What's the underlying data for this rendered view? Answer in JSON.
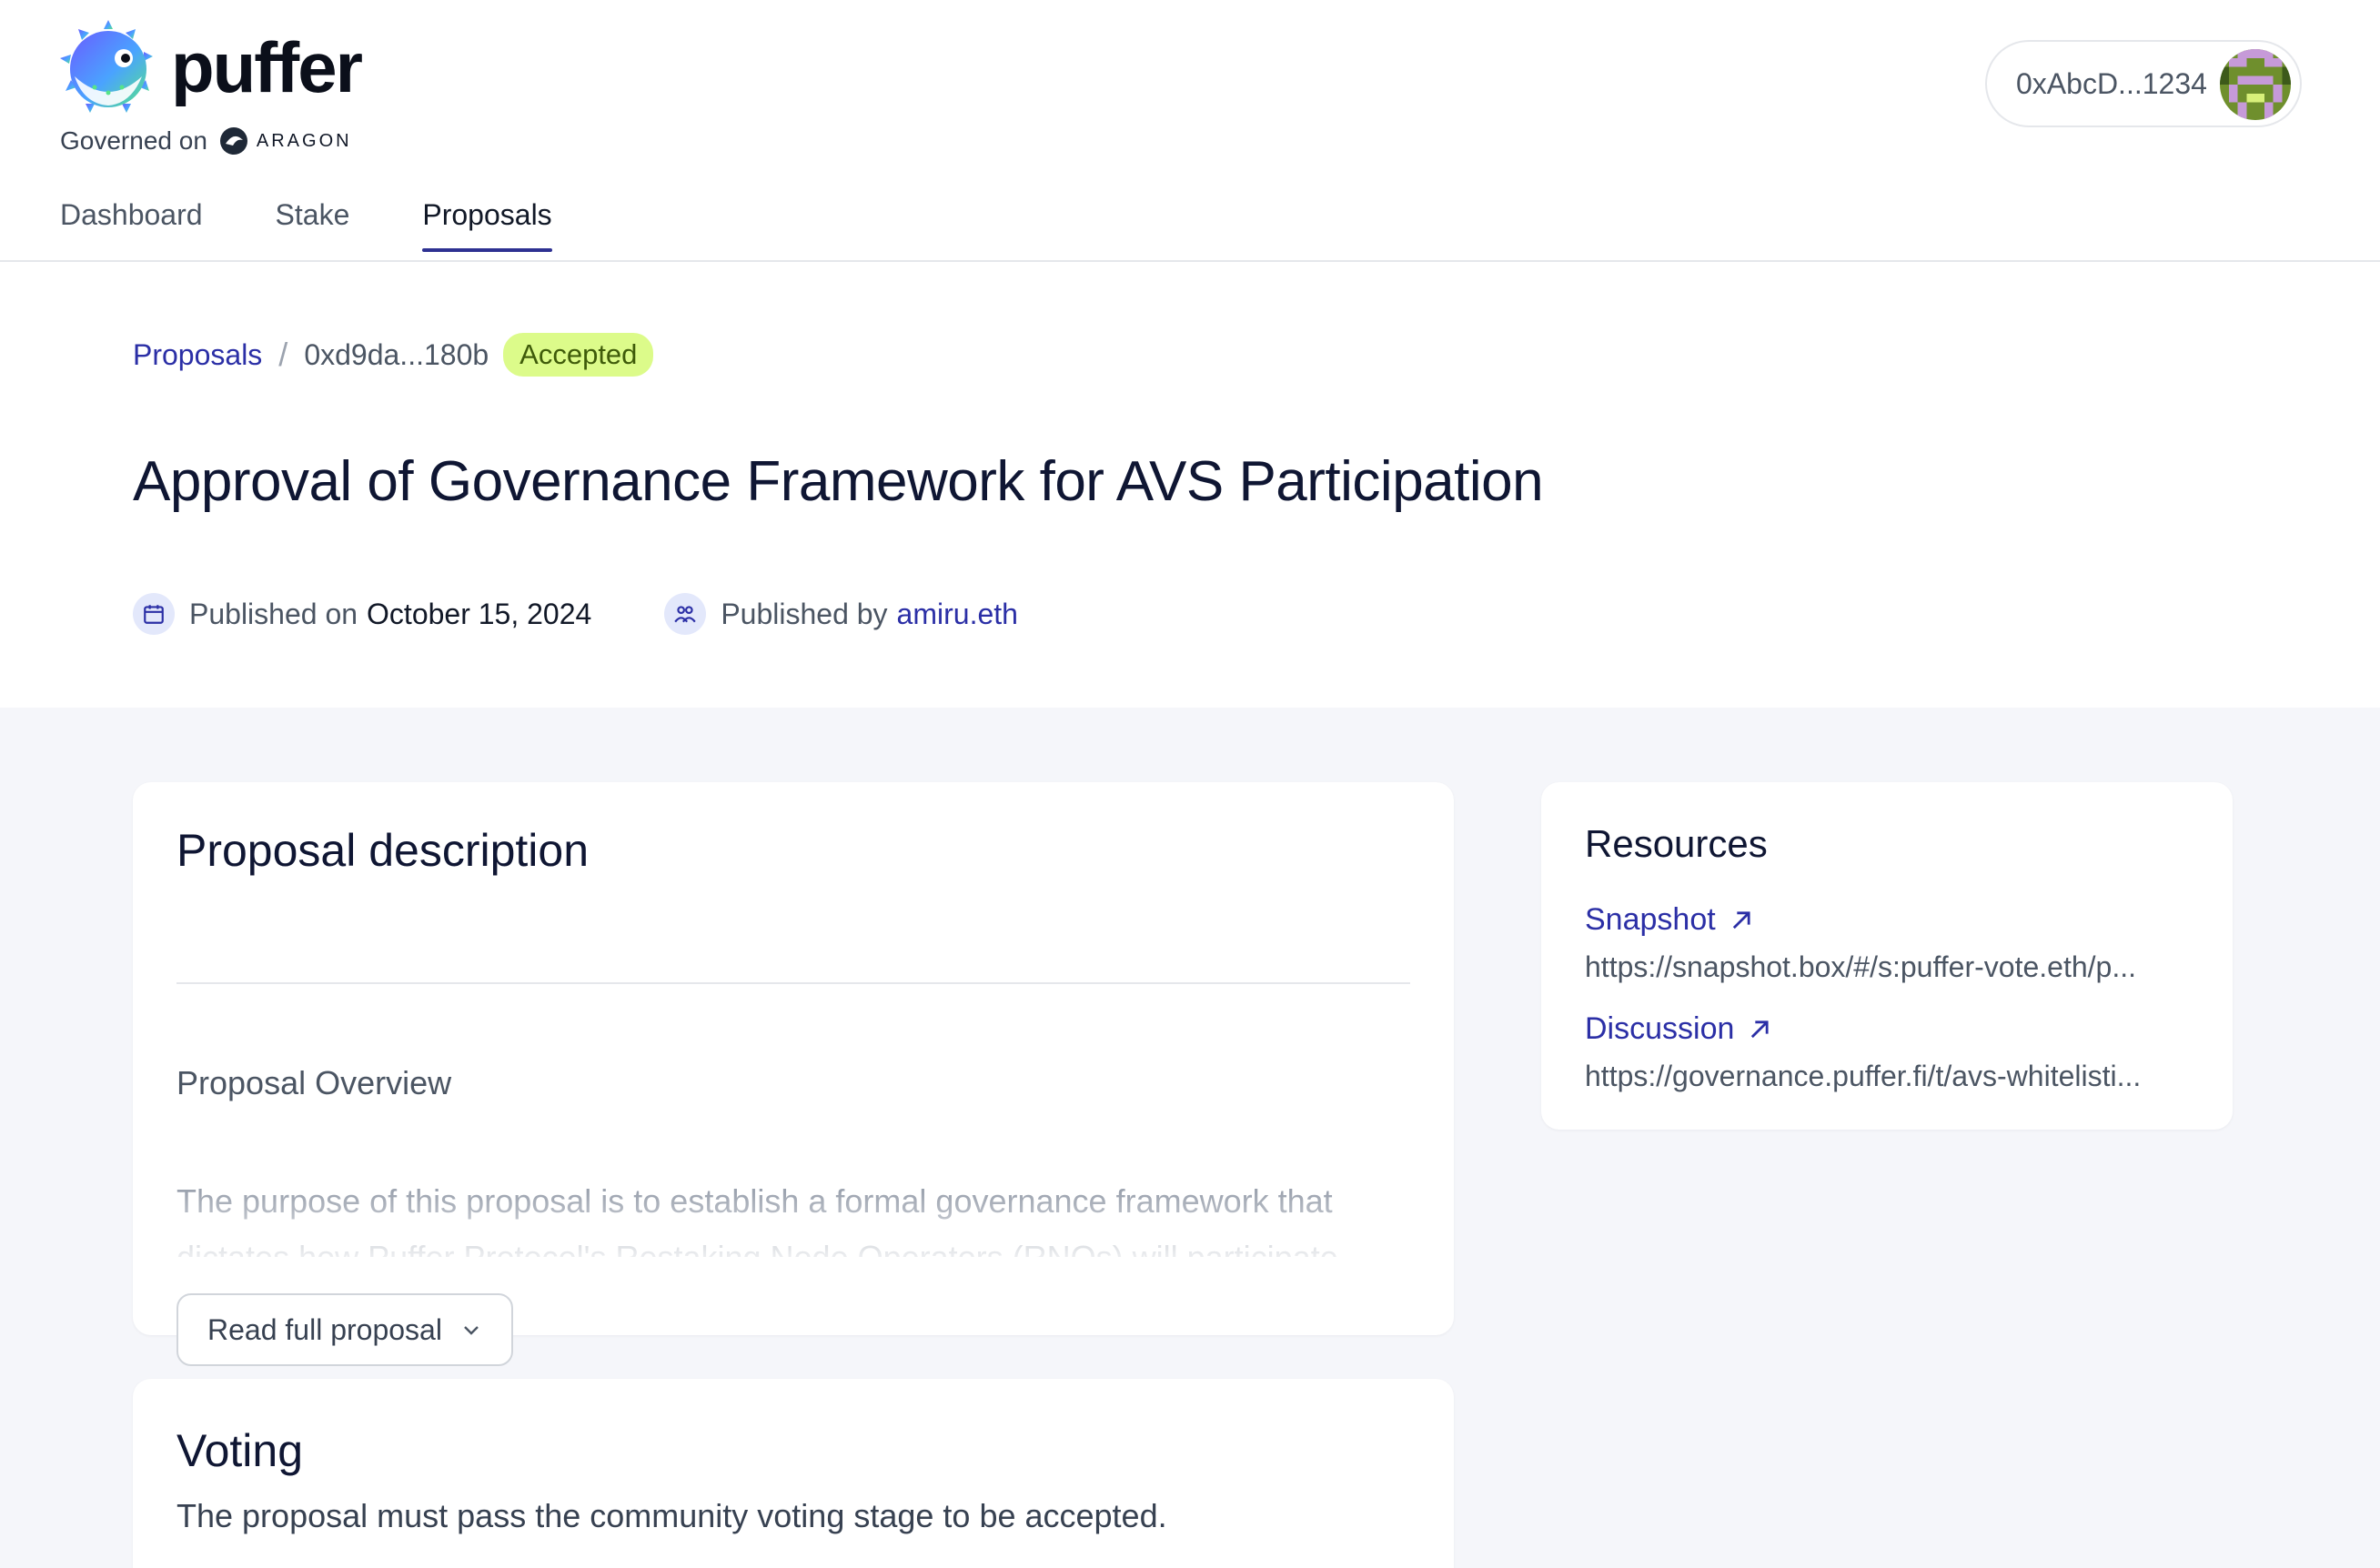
{
  "brand": {
    "name": "puffer",
    "governed_label": "Governed on",
    "aragon_label": "ARAGON"
  },
  "wallet": {
    "address": "0xAbcD...1234"
  },
  "nav": {
    "tabs": [
      {
        "label": "Dashboard",
        "active": false
      },
      {
        "label": "Stake",
        "active": false
      },
      {
        "label": "Proposals",
        "active": true
      }
    ]
  },
  "breadcrumb": {
    "root": "Proposals",
    "current": "0xd9da...180b",
    "status": "Accepted"
  },
  "proposal": {
    "title": "Approval of Governance Framework for AVS Participation",
    "published_on_label": "Published on",
    "published_on": "October 15, 2024",
    "published_by_label": "Published by",
    "published_by": "amiru.eth"
  },
  "description": {
    "heading": "Proposal description",
    "subheading": "Proposal Overview",
    "body": "The purpose of this proposal is to establish a formal governance framework that dictates how Puffer Protocol's Restaking Node Operators (RNOs) will participate",
    "read_more": "Read full proposal"
  },
  "voting": {
    "heading": "Voting",
    "subtext": "The proposal must pass the community voting stage to be accepted."
  },
  "resources": {
    "heading": "Resources",
    "items": [
      {
        "label": "Snapshot",
        "url": "https://snapshot.box/#/s:puffer-vote.eth/p..."
      },
      {
        "label": "Discussion",
        "url": "https://governance.puffer.fi/t/avs-whitelisti..."
      }
    ]
  },
  "colors": {
    "accent": "#2b2fa6",
    "status_accepted_bg": "#dcfb8a",
    "page_bg": "#f5f6fa"
  }
}
